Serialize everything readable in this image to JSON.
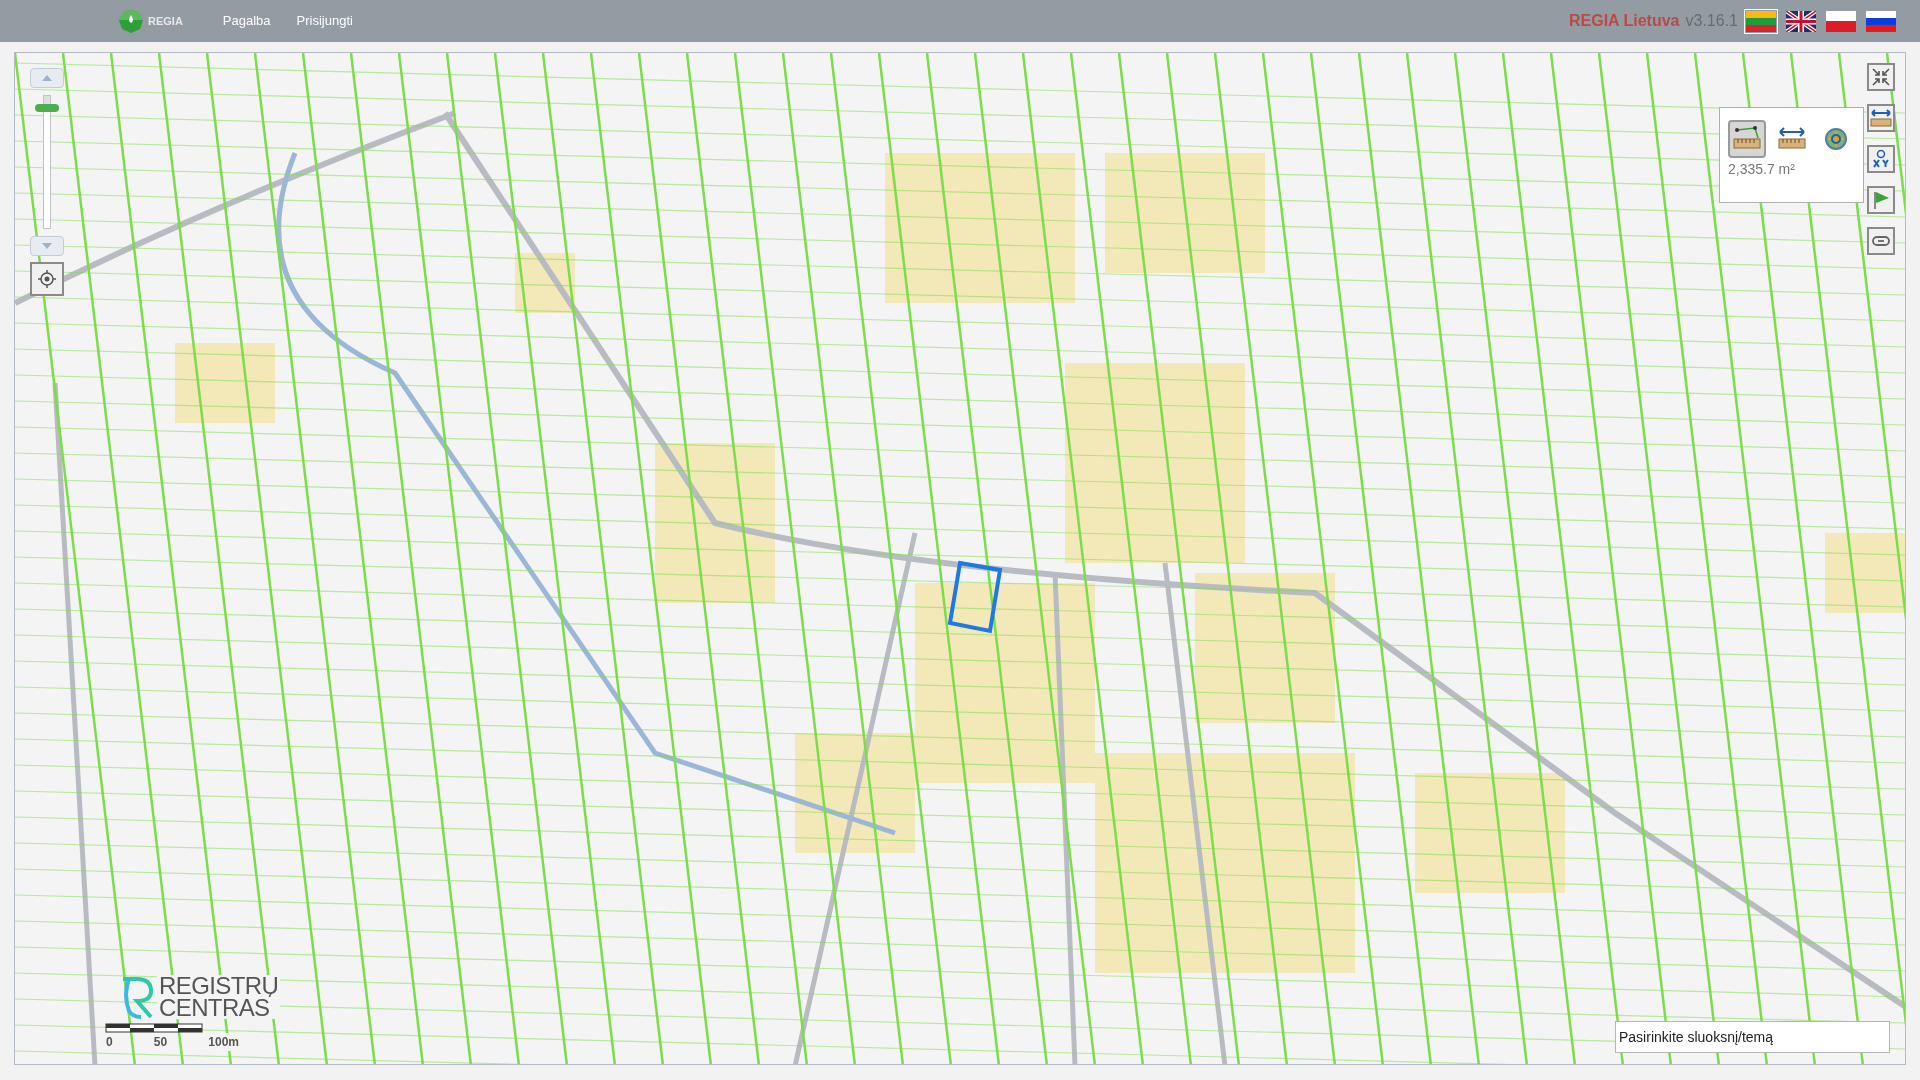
{
  "header": {
    "logo_text": "REGIA",
    "nav": [
      {
        "label": "Pagalba"
      },
      {
        "label": "Prisijungti"
      }
    ],
    "app_name": "REGIA Lietuva",
    "version": "v3.16.1",
    "languages": [
      {
        "kind": "lt",
        "selected": true
      },
      {
        "kind": "en",
        "selected": false
      },
      {
        "kind": "pl",
        "selected": false
      },
      {
        "kind": "ru",
        "selected": false
      }
    ]
  },
  "zoom_slider": {
    "level": 0.9
  },
  "measure_panel": {
    "tools": [
      {
        "kind": "area",
        "selected": true
      },
      {
        "kind": "distance",
        "selected": false
      },
      {
        "kind": "coordinates",
        "selected": false
      }
    ],
    "result": "2,335.7 m²"
  },
  "toolbar": [
    {
      "kind": "collapse"
    },
    {
      "kind": "measure"
    },
    {
      "kind": "xy"
    },
    {
      "kind": "flag"
    },
    {
      "kind": "link"
    }
  ],
  "scale_bar": {
    "labels": [
      "0",
      "50",
      "100m"
    ]
  },
  "provider_logo": {
    "line_1": "REGISTRŲ",
    "line_2": "CENTRAS"
  },
  "layer_select": {
    "placeholder": "Pasirinkite sluoksnį/temą"
  }
}
